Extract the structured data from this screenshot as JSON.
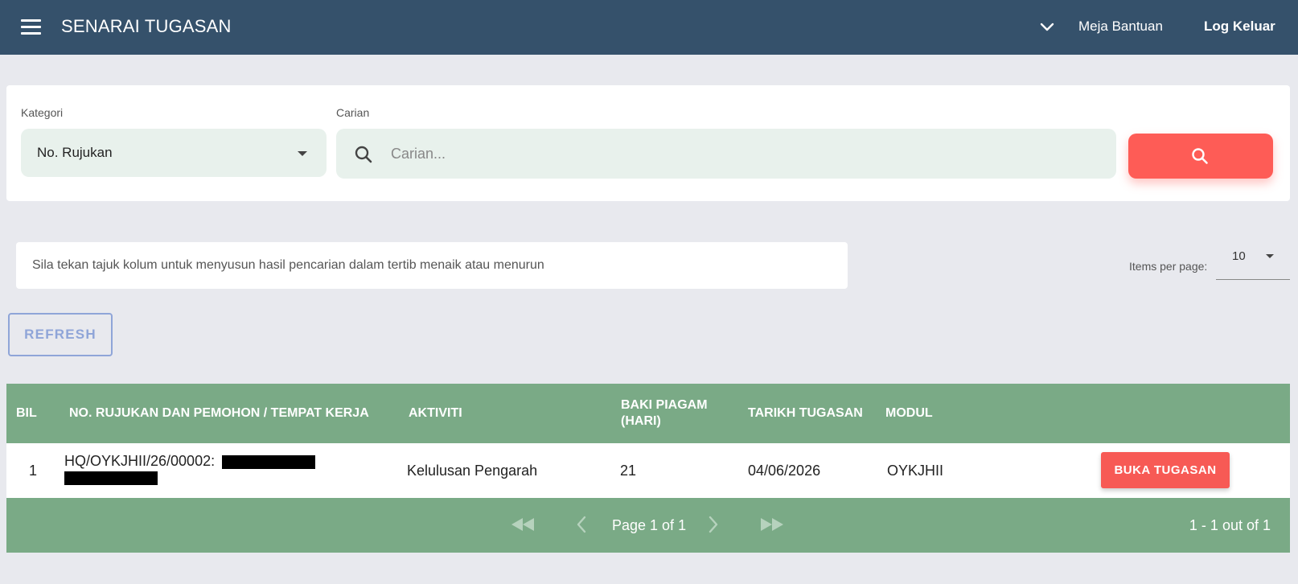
{
  "header": {
    "title": "SENARAI TUGASAN",
    "help_label": "Meja Bantuan",
    "logout_label": "Log Keluar"
  },
  "search": {
    "category_label": "Kategori",
    "category_value": "No. Rujukan",
    "search_label": "Carian",
    "search_placeholder": "Carian..."
  },
  "info": {
    "text": "Sila tekan tajuk kolum untuk menyusun hasil pencarian dalam tertib menaik atau menurun"
  },
  "pagination_top": {
    "items_per_page_label": "Items per page:",
    "items_per_page_value": "10"
  },
  "refresh_label": "REFRESH",
  "table": {
    "headers": {
      "bil": "BIL",
      "rujukan": "NO. RUJUKAN DAN PEMOHON / TEMPAT KERJA",
      "aktiviti": "AKTIVITI",
      "baki_line1": "BAKI PIAGAM",
      "baki_line2": "(HARI)",
      "tarikh": "TARIKH TUGASAN",
      "modul": "MODUL"
    },
    "rows": [
      {
        "bil": "1",
        "rujukan": "HQ/OYKJHII/26/00002:",
        "aktiviti": "Kelulusan Pengarah",
        "baki": "21",
        "tarikh": "04/06/2026",
        "modul": "OYKJHII",
        "action_label": "BUKA TUGASAN"
      }
    ]
  },
  "footer": {
    "page_text": "Page 1 of 1",
    "range_text": "1 - 1 out of 1"
  },
  "colors": {
    "topbar": "#35516b",
    "accent_red": "#fe5c56",
    "table_green": "#7aaa86",
    "field_bg": "#e8f1ec",
    "refresh_blue": "#8fa5d8"
  },
  "icons": [
    "menu-icon",
    "chevron-down-icon",
    "search-icon",
    "first-page-icon",
    "prev-page-icon",
    "next-page-icon",
    "last-page-icon"
  ]
}
